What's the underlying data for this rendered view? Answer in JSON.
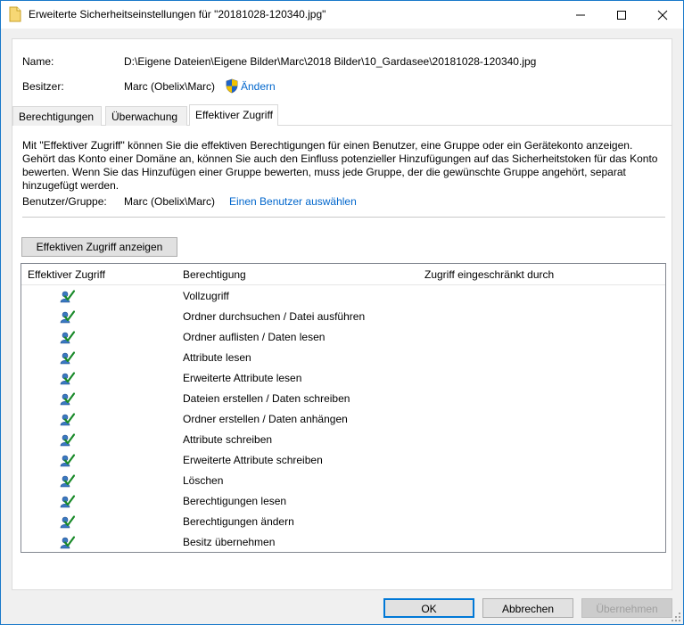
{
  "window": {
    "title": "Erweiterte Sicherheitseinstellungen für \"20181028-120340.jpg\""
  },
  "name_label": "Name:",
  "name_value": "D:\\Eigene Dateien\\Eigene Bilder\\Marc\\2018 Bilder\\10_Gardasee\\20181028-120340.jpg",
  "owner_label": "Besitzer:",
  "owner_value": "Marc (Obelix\\Marc)",
  "owner_change_link": "Ändern",
  "tabs": [
    {
      "label": "Berechtigungen"
    },
    {
      "label": "Überwachung"
    },
    {
      "label": "Effektiver Zugriff"
    }
  ],
  "description": "Mit \"Effektiver Zugriff\" können Sie die effektiven Berechtigungen für einen Benutzer, eine Gruppe oder ein Gerätekonto anzeigen. Gehört das Konto einer Domäne an, können Sie auch den Einfluss potenzieller Hinzufügungen auf das Sicherheitstoken für das Konto bewerten. Wenn Sie das Hinzufügen einer Gruppe bewerten, muss jede Gruppe, der die gewünschte Gruppe angehört, separat hinzugefügt werden.",
  "user_group_label": "Benutzer/Gruppe:",
  "user_group_value": "Marc (Obelix\\Marc)",
  "select_user_link": "Einen Benutzer auswählen",
  "show_access_button": "Effektiven Zugriff anzeigen",
  "grid": {
    "columns": [
      "Effektiver Zugriff",
      "Berechtigung",
      "Zugriff eingeschränkt durch"
    ],
    "rows": [
      {
        "permission": "Vollzugriff",
        "icon": "user-check-icon"
      },
      {
        "permission": "Ordner durchsuchen / Datei ausführen",
        "icon": "user-check-icon"
      },
      {
        "permission": "Ordner auflisten / Daten lesen",
        "icon": "user-check-icon"
      },
      {
        "permission": "Attribute lesen",
        "icon": "user-check-icon"
      },
      {
        "permission": "Erweiterte Attribute lesen",
        "icon": "user-check-icon"
      },
      {
        "permission": "Dateien erstellen / Daten schreiben",
        "icon": "user-check-icon"
      },
      {
        "permission": "Ordner erstellen / Daten anhängen",
        "icon": "user-check-icon"
      },
      {
        "permission": "Attribute schreiben",
        "icon": "user-check-icon"
      },
      {
        "permission": "Erweiterte Attribute schreiben",
        "icon": "user-check-icon"
      },
      {
        "permission": "Löschen",
        "icon": "user-check-icon"
      },
      {
        "permission": "Berechtigungen lesen",
        "icon": "user-check-icon"
      },
      {
        "permission": "Berechtigungen ändern",
        "icon": "user-check-icon"
      },
      {
        "permission": "Besitz übernehmen",
        "icon": "user-check-icon"
      }
    ]
  },
  "buttons": {
    "ok": "OK",
    "cancel": "Abbrechen",
    "apply": "Übernehmen"
  },
  "colors": {
    "accent": "#0078d7",
    "link": "#0066cc",
    "window_border": "#1979ca"
  }
}
